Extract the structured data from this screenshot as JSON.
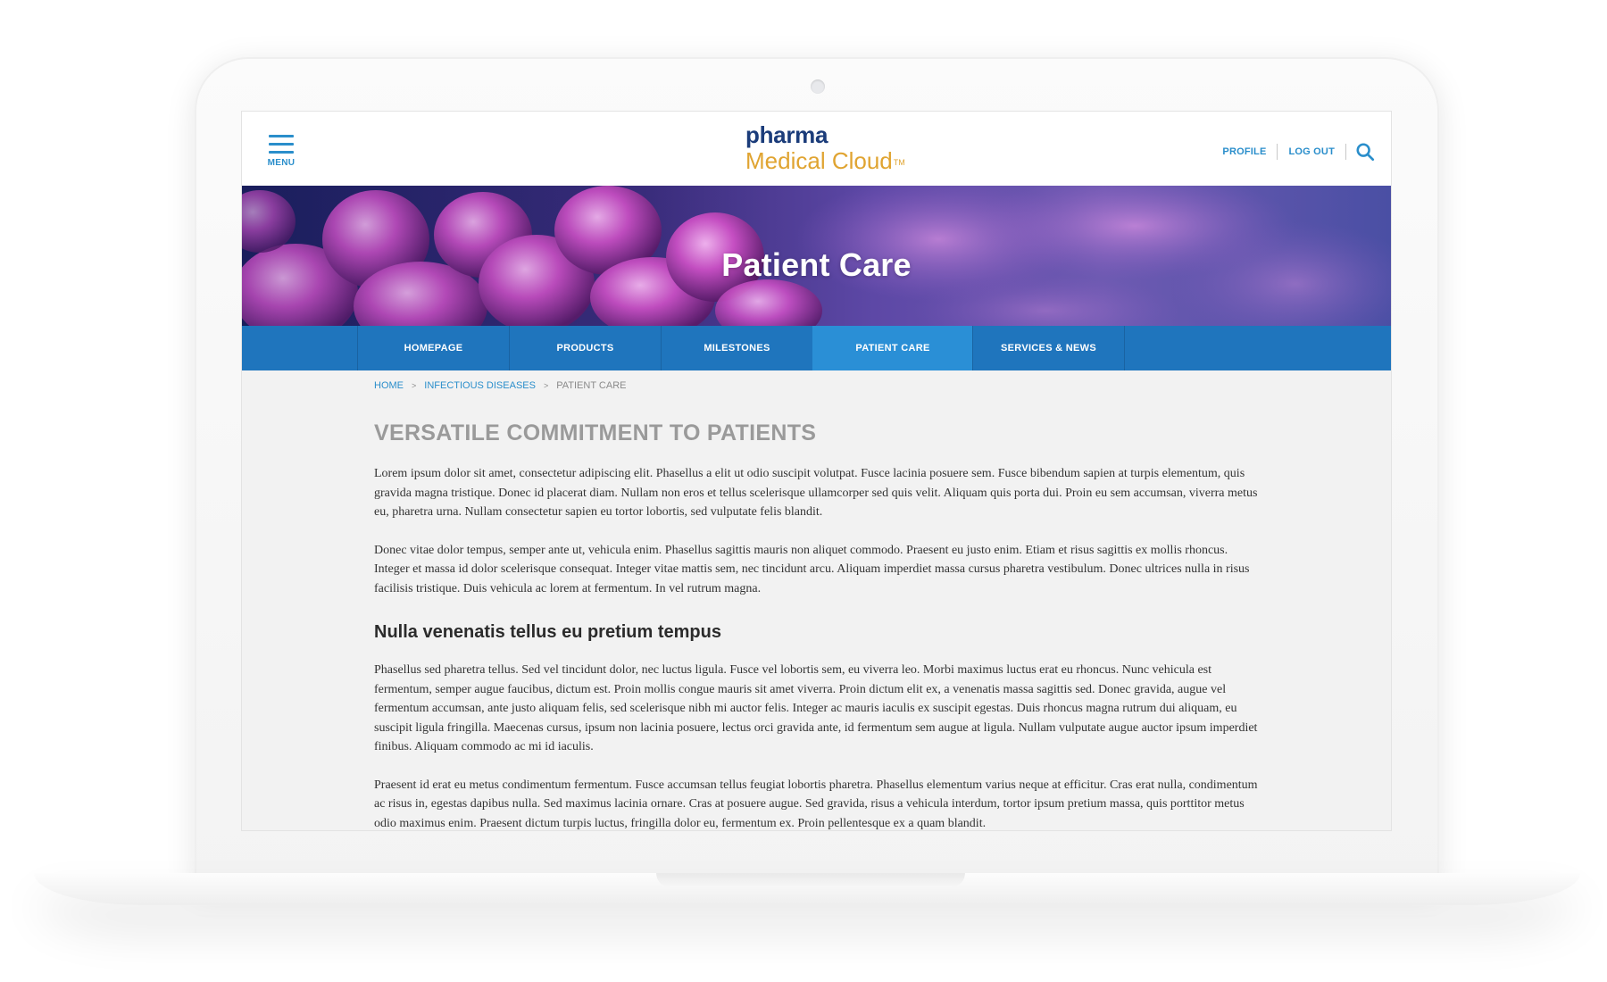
{
  "header": {
    "menu_label": "MENU",
    "logo_line1": "pharma",
    "logo_line2": "Medical Cloud",
    "logo_tm": "TM",
    "profile_link": "PROFILE",
    "logout_link": "LOG OUT"
  },
  "hero": {
    "title": "Patient Care"
  },
  "nav": {
    "items": [
      {
        "label": "HOMEPAGE"
      },
      {
        "label": "PRODUCTS"
      },
      {
        "label": "MILESTONES"
      },
      {
        "label": "PATIENT CARE",
        "active": true
      },
      {
        "label": "SERVICES & NEWS"
      }
    ]
  },
  "breadcrumb": {
    "home": "HOME",
    "category": "INFECTIOUS DISEASES",
    "current": "PATIENT CARE",
    "separator": ">"
  },
  "article": {
    "title": "VERSATILE COMMITMENT TO PATIENTS",
    "paragraph1": "Lorem ipsum dolor sit amet, consectetur adipiscing elit. Phasellus a elit ut odio suscipit volutpat. Fusce lacinia posuere sem. Fusce bibendum sapien at turpis elementum, quis gravida magna tristique. Donec id placerat diam. Nullam non eros et tellus scelerisque ullamcorper sed quis velit. Aliquam quis porta dui. Proin eu sem accumsan, viverra metus eu, pharetra urna. Nullam consectetur sapien eu tortor lobortis, sed vulputate felis blandit.",
    "paragraph2": "Donec vitae dolor tempus, semper ante ut, vehicula enim. Phasellus sagittis mauris non aliquet commodo. Praesent eu justo enim. Etiam et risus sagittis ex mollis rhoncus. Integer et massa id dolor scelerisque consequat. Integer vitae mattis sem, nec tincidunt arcu. Aliquam imperdiet massa cursus pharetra vestibulum. Donec ultrices nulla in risus facilisis tristique. Duis vehicula ac lorem at fermentum. In vel rutrum magna.",
    "subheading": "Nulla venenatis tellus eu pretium tempus",
    "paragraph3": "Phasellus sed pharetra tellus. Sed vel tincidunt dolor, nec luctus ligula. Fusce vel lobortis sem, eu viverra leo. Morbi maximus luctus erat eu rhoncus. Nunc vehicula est fermentum, semper augue faucibus, dictum est. Proin mollis congue mauris sit amet viverra. Proin dictum elit ex, a venenatis massa sagittis sed. Donec gravida, augue vel fermentum accumsan, ante justo aliquam felis, sed scelerisque nibh mi auctor felis. Integer ac mauris iaculis ex suscipit egestas. Duis rhoncus magna rutrum dui aliquam, eu suscipit ligula fringilla. Maecenas cursus, ipsum non lacinia posuere, lectus orci gravida ante, id fermentum sem augue at ligula. Nullam vulputate augue auctor ipsum imperdiet finibus. Aliquam commodo ac mi id iaculis.",
    "paragraph4": "Praesent id erat eu metus condimentum fermentum. Fusce accumsan tellus feugiat lobortis pharetra. Phasellus elementum varius neque at efficitur. Cras erat nulla, condimentum ac risus in, egestas dapibus nulla. Sed maximus lacinia ornare. Cras at posuere augue. Sed gravida, risus a vehicula interdum, tortor ipsum pretium massa, quis porttitor metus odio maximus enim. Praesent dictum turpis luctus, fringilla dolor eu, fermentum ex. Proin pellentesque ex a quam blandit."
  },
  "icons": {
    "menu": "hamburger-menu-icon",
    "search": "search-icon"
  },
  "colors": {
    "accent_blue": "#2a8ecb",
    "nav_blue": "#1f75bd",
    "nav_active": "#2a8fd6",
    "logo_navy": "#1b3c7a",
    "logo_gold": "#e0a431",
    "title_gray": "#9a9a9a"
  }
}
